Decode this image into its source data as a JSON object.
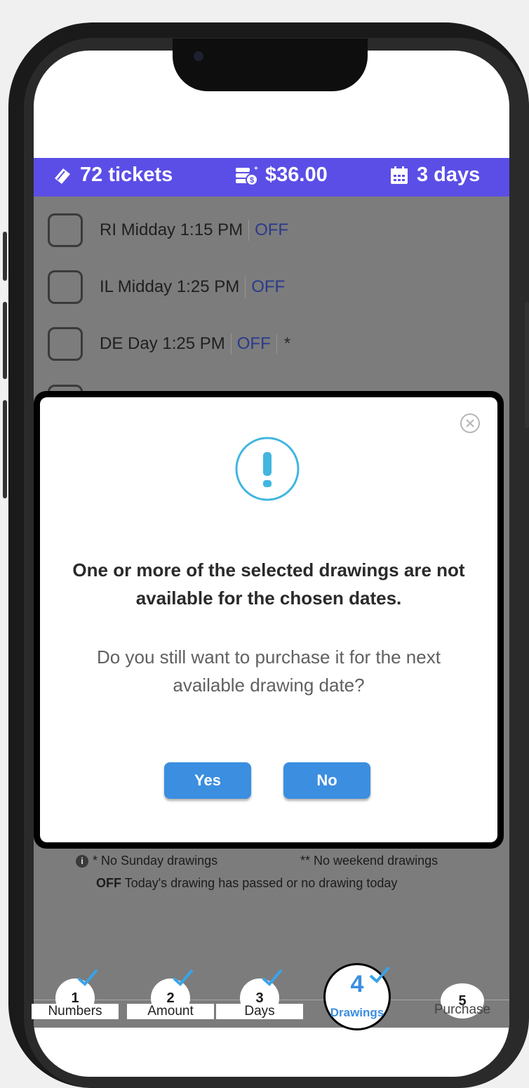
{
  "summary": {
    "tickets": "72 tickets",
    "amount": "$36.00",
    "days": "3 days"
  },
  "drawings": [
    {
      "label": "RI Midday 1:15 PM",
      "status": "OFF",
      "note": ""
    },
    {
      "label": "IL Midday 1:25 PM",
      "status": "OFF",
      "note": ""
    },
    {
      "label": "DE Day 1:25 PM",
      "status": "OFF",
      "note": "*"
    }
  ],
  "modal": {
    "title": "One or more of the selected drawings are not available for the chosen dates.",
    "message": "Do you still want to purchase it for the next available drawing date?",
    "yes_label": "Yes",
    "no_label": "No"
  },
  "footnotes": {
    "no_sunday": "* No Sunday drawings",
    "no_weekend": "** No weekend drawings",
    "off_key": "OFF",
    "off_text": "Today's drawing has passed or no drawing today"
  },
  "steps": [
    {
      "number": "1",
      "label": "Numbers",
      "done": true
    },
    {
      "number": "2",
      "label": "Amount",
      "done": true
    },
    {
      "number": "3",
      "label": "Days",
      "done": true
    },
    {
      "number": "4",
      "label": "Drawings",
      "done": true,
      "active": true
    },
    {
      "number": "5",
      "label": "Purchase",
      "done": false
    }
  ],
  "colors": {
    "accent_bar": "#5b4ee6",
    "button": "#3b8ee0",
    "warning": "#41b6e0",
    "check": "#3aa3e8"
  }
}
